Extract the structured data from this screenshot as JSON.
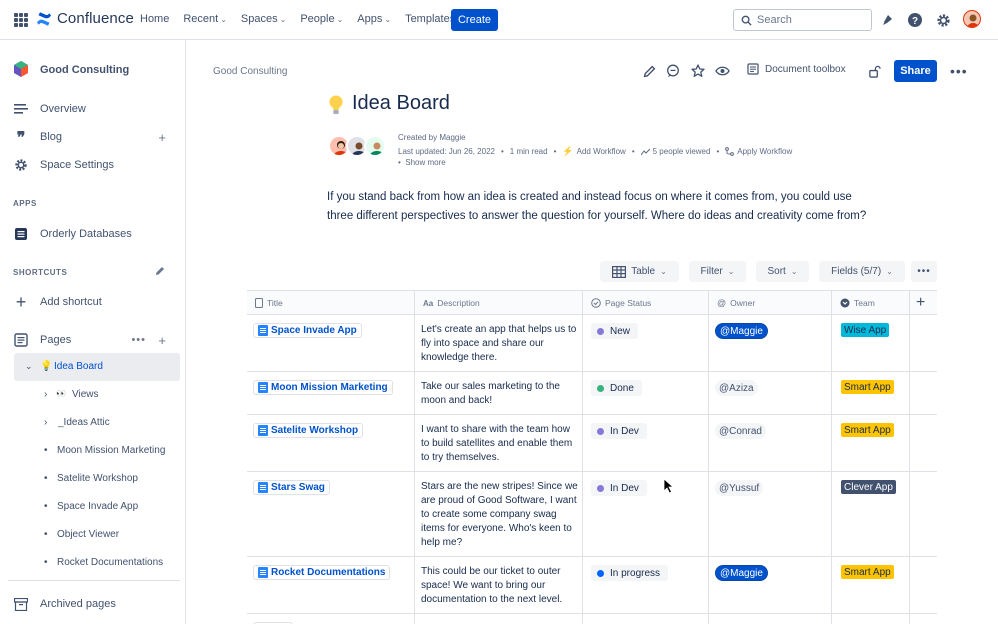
{
  "topnav": {
    "app_name": "Confluence",
    "items": [
      {
        "label": "Home",
        "has_menu": false
      },
      {
        "label": "Recent",
        "has_menu": true
      },
      {
        "label": "Spaces",
        "has_menu": true
      },
      {
        "label": "People",
        "has_menu": true
      },
      {
        "label": "Apps",
        "has_menu": true
      },
      {
        "label": "Templates",
        "has_menu": false
      }
    ],
    "create_label": "Create",
    "search_placeholder": "Search",
    "icons": [
      "notifications-icon",
      "help-icon",
      "settings-icon",
      "profile-avatar"
    ]
  },
  "sidebar": {
    "space_name": "Good Consulting",
    "nav": [
      {
        "label": "Overview",
        "icon": "overview-icon"
      },
      {
        "label": "Blog",
        "icon": "quote-icon"
      },
      {
        "label": "Space Settings",
        "icon": "gear-icon"
      }
    ],
    "apps_heading": "APPS",
    "apps": [
      {
        "label": "Orderly Databases",
        "icon": "database-icon"
      }
    ],
    "shortcuts_heading": "SHORTCUTS",
    "add_shortcut_label": "Add shortcut",
    "pages_label": "Pages",
    "tree": [
      {
        "label": "Idea Board",
        "prefix": "💡",
        "active": true
      },
      {
        "label": "Views",
        "prefix": "👀"
      },
      {
        "label": "_Ideas Attic",
        "prefix": ""
      },
      {
        "label": "Moon Mission Marketing"
      },
      {
        "label": "Satelite Workshop"
      },
      {
        "label": "Space Invade App"
      },
      {
        "label": "Object Viewer"
      },
      {
        "label": "Rocket Documentations"
      }
    ],
    "archived_label": "Archived pages"
  },
  "page": {
    "breadcrumb": "Good Consulting",
    "doc_toolbox_label": "Document toolbox",
    "share_label": "Share",
    "title": "Idea Board",
    "created_by": "Created by Maggie",
    "last_updated": "Last updated: Jun 26, 2022",
    "read_time": "1 min read",
    "add_workflow": "Add Workflow",
    "viewed": "5 people viewed",
    "apply_workflow": "Apply Workflow",
    "show_more": "Show more",
    "intro": "If you stand back from how an idea is created and instead focus on where it comes from, you could use three different perspectives to answer the question for yourself. Where do ideas and creativity come from?"
  },
  "toolbar": {
    "table": "Table",
    "filter": "Filter",
    "sort": "Sort",
    "fields": "Fields (5/7)"
  },
  "table": {
    "headers": {
      "title": "Title",
      "description": "Description",
      "status": "Page Status",
      "owner": "Owner",
      "team": "Team"
    },
    "rows": [
      {
        "title": "Space Invade App",
        "description": "Let's create an app that helps us to fly into space and share our knowledge there.",
        "status": "New",
        "status_color": "#8777d9",
        "owner": "@Maggie",
        "owner_strong": true,
        "team": "Wise App",
        "team_bg": "#00b8d9",
        "team_fg": "#172b4d"
      },
      {
        "title": "Moon Mission Marketing",
        "description": "Take our sales marketing to the moon and back!",
        "status": "Done",
        "status_color": "#36b37e",
        "owner": "@Aziza",
        "owner_strong": false,
        "team": "Smart App",
        "team_bg": "#ffc400",
        "team_fg": "#172b4d"
      },
      {
        "title": "Satelite Workshop",
        "description": "I want to share with the team how to build satellites and enable them to try themselves.",
        "status": "In Dev",
        "status_color": "#8777d9",
        "owner": "@Conrad",
        "owner_strong": false,
        "team": "Smart App",
        "team_bg": "#ffc400",
        "team_fg": "#172b4d"
      },
      {
        "title": "Stars Swag",
        "description": "Stars are the new stripes! Since we are proud of Good Software, I want to create some company swag items for everyone. Who's keen to help me?",
        "status": "In Dev",
        "status_color": "#8777d9",
        "owner": "@Yussuf",
        "owner_strong": false,
        "team": "Clever App",
        "team_bg": "#42526e",
        "team_fg": "#ffffff"
      },
      {
        "title": "Rocket Documentations",
        "description": "This could be our ticket to outer space! We want to bring our documentation to the next level.",
        "status": "In progress",
        "status_color": "#0065ff",
        "owner": "@Maggie",
        "owner_strong": true,
        "team": "Smart App",
        "team_bg": "#ffc400",
        "team_fg": "#172b4d"
      }
    ]
  }
}
